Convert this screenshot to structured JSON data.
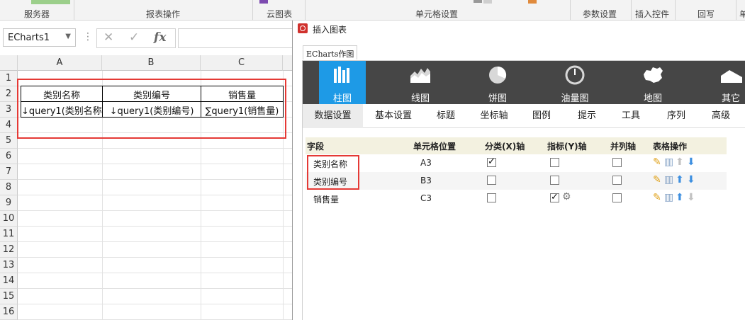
{
  "ribbon": {
    "groups": [
      "服务器",
      "报表操作",
      "云图表",
      "单元格设置",
      "参数设置",
      "插入控件",
      "回写",
      "单"
    ]
  },
  "formula_bar": {
    "name_box": "ECharts1",
    "cancel_icon": "✕",
    "confirm_icon": "✓",
    "fx_icon": "fx"
  },
  "sheet": {
    "columns": [
      "A",
      "B",
      "C"
    ],
    "rows": [
      "1",
      "2",
      "3",
      "4",
      "5",
      "6",
      "7",
      "8",
      "9",
      "10",
      "11",
      "12",
      "13",
      "14",
      "15",
      "16"
    ],
    "header_row": [
      "类别名称",
      "类别编号",
      "销售量"
    ],
    "data_row": [
      "↓query1(类别名称)",
      "↓query1(类别编号)",
      "∑query1(销售量)"
    ]
  },
  "dialog": {
    "title": "插入图表",
    "tab": "ECharts作图",
    "chart_types": [
      {
        "label": "柱图",
        "icon": "bar-chart-icon",
        "active": true
      },
      {
        "label": "线图",
        "icon": "line-chart-icon",
        "active": false
      },
      {
        "label": "饼图",
        "icon": "pie-chart-icon",
        "active": false
      },
      {
        "label": "油量图",
        "icon": "gauge-chart-icon",
        "active": false
      },
      {
        "label": "地图",
        "icon": "map-chart-icon",
        "active": false
      },
      {
        "label": "其它",
        "icon": "area-chart-icon",
        "active": false
      }
    ],
    "sub_tabs": [
      "数据设置",
      "基本设置",
      "标题",
      "坐标轴",
      "图例",
      "提示",
      "工具",
      "序列",
      "高级"
    ],
    "table": {
      "headers": [
        "字段",
        "单元格位置",
        "分类(X)轴",
        "指标(Y)轴",
        "并列轴",
        "表格操作"
      ],
      "rows": [
        {
          "field": "类别名称",
          "cell": "A3",
          "x": true,
          "y": false,
          "parallel": false,
          "up": false,
          "down": true
        },
        {
          "field": "类别编号",
          "cell": "B3",
          "x": false,
          "y": false,
          "parallel": false,
          "up": true,
          "down": true
        },
        {
          "field": "销售量",
          "cell": "C3",
          "x": false,
          "y": true,
          "parallel": false,
          "up": true,
          "down": false
        }
      ]
    }
  },
  "colors": {
    "accent": "#1e9ae6",
    "highlight_border": "#e53935",
    "typebar_bg": "#464646"
  }
}
